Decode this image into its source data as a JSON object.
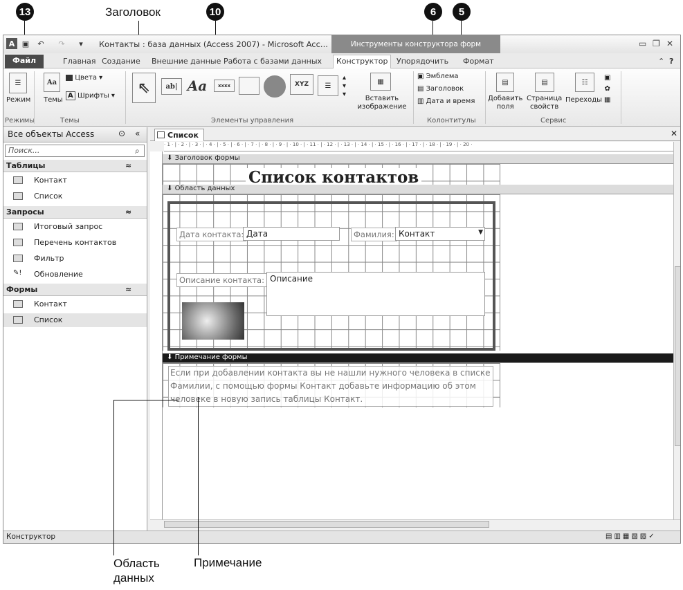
{
  "annotations": {
    "badges": [
      "13",
      "10",
      "6",
      "5"
    ],
    "header_label": "Заголовок",
    "data_label_line1": "Область",
    "data_label_line2": "данных",
    "note_label": "Примечание"
  },
  "window": {
    "title": "Контакты : база данных (Access 2007) - Microsoft Acc...",
    "context_band": "Инструменты конструктора форм"
  },
  "tabs": [
    "Файл",
    "Главная",
    "Создание",
    "Внешние данные",
    "Работа с базами данных",
    "Конструктор",
    "Упорядочить",
    "Формат"
  ],
  "ribbon": {
    "modes": {
      "btn": "Режим",
      "group": "Режимы"
    },
    "themes": {
      "themes": "Темы",
      "colors": "Цвета",
      "fonts": "Шрифты",
      "group": "Темы"
    },
    "controls": {
      "group": "Элементы управления",
      "insert_image": "Вставить изображение"
    },
    "headers": {
      "logo": "Эмблема",
      "title": "Заголовок",
      "datetime": "Дата и время",
      "group": "Колонтитулы"
    },
    "service": {
      "add_fields_1": "Добавить",
      "add_fields_2": "поля",
      "props_1": "Страница",
      "props_2": "свойств",
      "transitions": "Переходы",
      "group": "Сервис"
    }
  },
  "nav": {
    "header": "Все объекты Access",
    "search_placeholder": "Поиск...",
    "sections": [
      {
        "title": "Таблицы",
        "items": [
          "Контакт",
          "Список"
        ]
      },
      {
        "title": "Запросы",
        "items": [
          "Итоговый запрос",
          "Перечень контактов",
          "Фильтр",
          "Обновление"
        ]
      },
      {
        "title": "Формы",
        "items": [
          "Контакт",
          "Список"
        ]
      }
    ]
  },
  "doc": {
    "tab": "Список",
    "ruler": "· 1 · | · 2 · | · 3 · | · 4 · | · 5 · | · 6 · | · 7 · | · 8 · | · 9 · | · 10 · | · 11 · | · 12 · | · 13 · | · 14 · | · 15 · | · 16 · | · 17 · | · 18 · | · 19 · | · 20 ·",
    "header_section": "Заголовок формы",
    "form_title": "Список контактов",
    "detail_section": "Область данных",
    "date_label": "Дата контакта:",
    "date_field": "Дата",
    "surname_label": "Фамилия:",
    "surname_field": "Контакт",
    "desc_label": "Описание контакта:",
    "desc_field": "Описание",
    "footer_section": "Примечание формы",
    "footer_text": "Если при добавлении контакта вы не нашли нужного человека в списке Фамилии, с помощью формы Контакт добавьте информацию об этом человеке в новую запись таблицы Контакт."
  },
  "status": "Конструктор"
}
